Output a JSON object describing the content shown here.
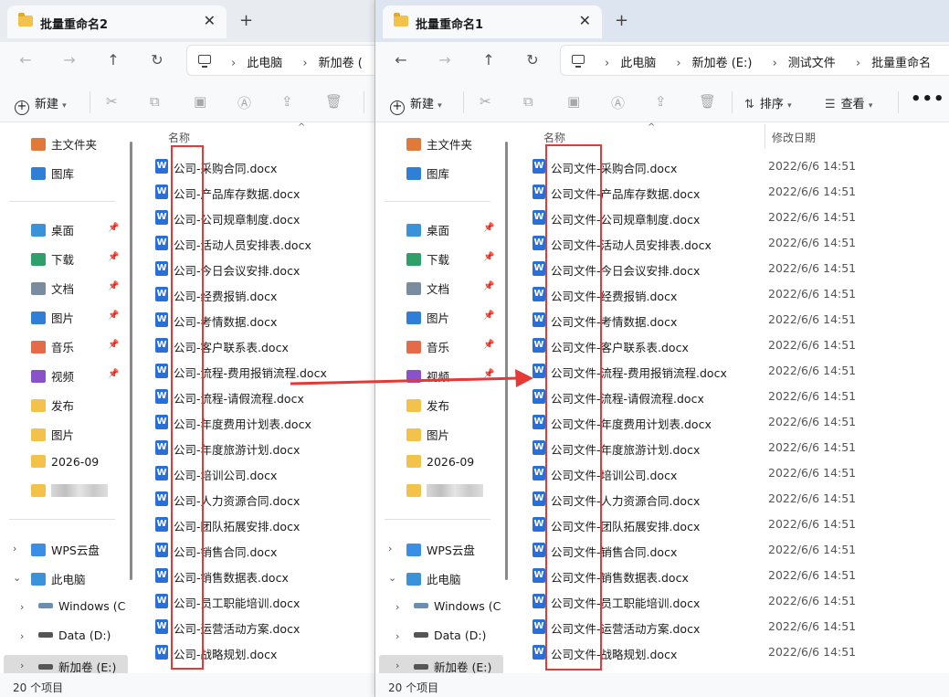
{
  "windows": [
    {
      "id": "win2",
      "tab_title": "批量重命名2",
      "breadcrumbs": [
        "此电脑",
        "新加卷 ("
      ],
      "status": "20 个项目",
      "prefix": "公司-"
    },
    {
      "id": "win1",
      "tab_title": "批量重命名1",
      "breadcrumbs": [
        "此电脑",
        "新加卷 (E:)",
        "测试文件",
        "批量重命名"
      ],
      "status": "20 个项目",
      "prefix": "公司文件-"
    }
  ],
  "toolbar": {
    "new_label": "新建",
    "sort_label": "排序",
    "view_label": "查看",
    "more_label": "•••"
  },
  "columns": {
    "name": "名称",
    "modified": "修改日期"
  },
  "sidebar": {
    "quick": [
      {
        "label": "主文件夹",
        "icon": "home-icon"
      },
      {
        "label": "图库",
        "icon": "gallery-icon"
      }
    ],
    "pinned": [
      {
        "label": "桌面",
        "icon": "desktop-icon"
      },
      {
        "label": "下载",
        "icon": "download-icon"
      },
      {
        "label": "文档",
        "icon": "document-icon"
      },
      {
        "label": "图片",
        "icon": "pictures-icon"
      },
      {
        "label": "音乐",
        "icon": "music-icon"
      },
      {
        "label": "视频",
        "icon": "video-icon"
      }
    ],
    "folders": [
      "发布",
      "图片",
      "2026-09"
    ],
    "tree": {
      "wps": "WPS云盘",
      "pc": "此电脑",
      "windows": "Windows (C",
      "data": "Data (D:)",
      "newvol": "新加卷 (E:)"
    }
  },
  "files": [
    "采购合同.docx",
    "产品库存数据.docx",
    "公司规章制度.docx",
    "活动人员安排表.docx",
    "今日会议安排.docx",
    "经费报销.docx",
    "考情数据.docx",
    "客户联系表.docx",
    "流程-费用报销流程.docx",
    "流程-请假流程.docx",
    "年度费用计划表.docx",
    "年度旅游计划.docx",
    "培训公司.docx",
    "人力资源合同.docx",
    "团队拓展安排.docx",
    "销售合同.docx",
    "销售数据表.docx",
    "员工职能培训.docx",
    "运营活动方案.docx",
    "战略规划.docx"
  ],
  "file_date": "2022/6/6 14:51",
  "colors": {
    "highlight": "#e53935",
    "word_blue": "#2b6fd6",
    "folder": "#f3c24a"
  }
}
